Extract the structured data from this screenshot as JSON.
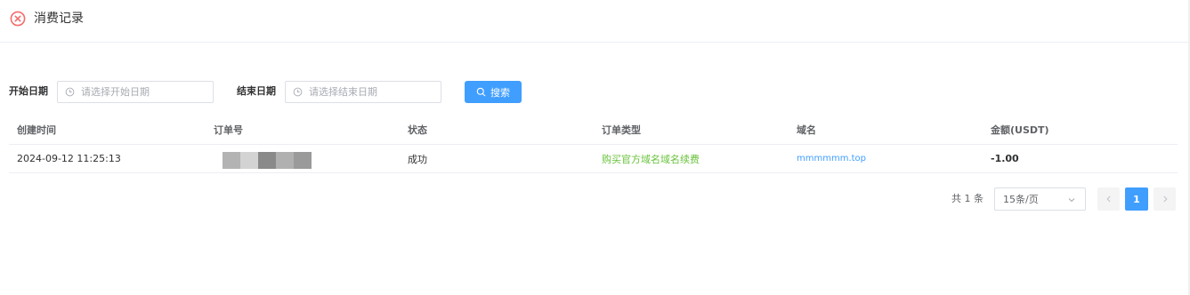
{
  "header": {
    "title": "消费记录",
    "back_icon": "close-circle-icon",
    "accent_color": "#f56c6c"
  },
  "filters": {
    "start_label": "开始日期",
    "start_placeholder": "请选择开始日期",
    "end_label": "结束日期",
    "end_placeholder": "请选择结束日期",
    "search_label": "搜索",
    "search_icon": "search-icon",
    "primary_color": "#409eff"
  },
  "table": {
    "columns": [
      "创建时间",
      "订单号",
      "状态",
      "订单类型",
      "域名",
      "金额(USDT)"
    ],
    "rows": [
      {
        "created_at": "2024-09-12 11:25:13",
        "order_no": "",
        "status": "成功",
        "order_type": "购买官方域名域名续费",
        "domain": "mmmmmm.top",
        "amount": "-1.00"
      }
    ]
  },
  "pagination": {
    "total_text": "共 1 条",
    "page_size": "15条/页",
    "current_page": "1",
    "prev_icon": "chevron-left-icon",
    "next_icon": "chevron-right-icon"
  }
}
